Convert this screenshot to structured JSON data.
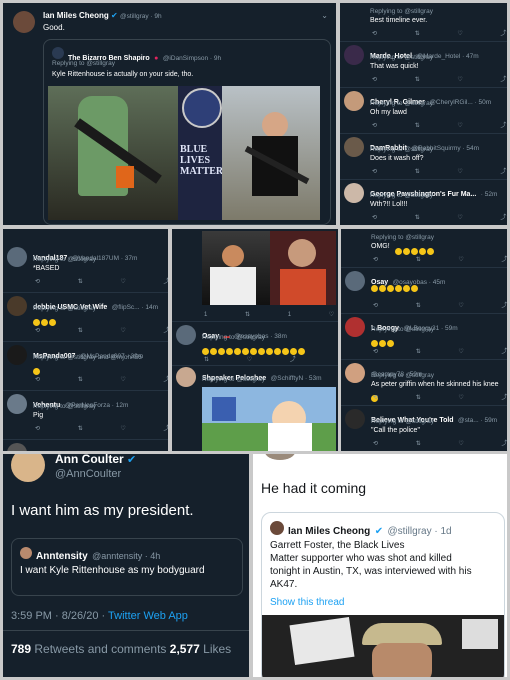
{
  "p1": {
    "author": {
      "name": "Ian Miles Cheong",
      "handle": "@stillgray · 9h"
    },
    "text": "Good.",
    "quoted": {
      "name": "The Bizarro Ben Shapiro",
      "handle": "@iDanSimpson · 9h",
      "reply": "Replying to @stillgray",
      "text": "Kyle Rittenhouse is actually on your side, tho.",
      "sign": [
        "BLUE",
        "LIVES",
        "MATTER"
      ]
    }
  },
  "p2": {
    "tweets": [
      {
        "name": "",
        "handle": "",
        "reply": "Replying to @stillgray",
        "text": "Best timeline ever."
      },
      {
        "name": "Marde_Hotel",
        "handle": "@Marde_Hotel · 47m",
        "reply": "Replying to @stillgray",
        "text": "That was quick!"
      },
      {
        "name": "Cheryl R. Gilmer",
        "handle": "@CherylRGil... · 50m",
        "reply": "Replying to @stillgray",
        "text": "Oh my lawd"
      },
      {
        "name": "DamRabbit",
        "handle": "@RabbitSquirmy · 54m",
        "reply": "Replying to @stillgray",
        "text": "Does it wash off?"
      },
      {
        "name": "George Pawshington's Fur Ma...",
        "handle": "· 52m",
        "reply": "Replying to @stillgray",
        "text": "Wth?!! Lol!!!"
      }
    ]
  },
  "p3": {
    "tweets": [
      {
        "name": "Vandal187",
        "handle": "@Vandal187UM · 37m",
        "reply": "Replying to @stillgray",
        "text": "*BASED"
      },
      {
        "name": "debbie USMC Vet Wife",
        "handle": "@flipSc... · 14m",
        "reply": "Replying to @stillgray",
        "text": ""
      },
      {
        "name": "MsPanda007",
        "handle": "@MsPanda007 · 39m",
        "reply": "Replying to @stillgray and @mjohn55",
        "text": ""
      },
      {
        "name": "Vehentu",
        "handle": "@PerNonForza · 12m",
        "reply": "Replying to @stillgray",
        "text": "Pig"
      },
      {
        "name": "Liberty Pact",
        "handle": "@LibertyPact · 45m",
        "reply": "",
        "text": ""
      }
    ]
  },
  "p4": {
    "tweets": [
      {
        "name": "Osay",
        "handle": "@osayobas · 38m",
        "reply": "Replying to @stillgray",
        "text": ""
      },
      {
        "name": "Shpeaker Peloshee",
        "handle": "@SchifftyN · 53m",
        "reply": "Replying to @stillgray",
        "text": ""
      }
    ]
  },
  "p5": {
    "tweets": [
      {
        "name": "",
        "handle": "",
        "reply": "Replying to @stillgray",
        "text": "OMG!"
      },
      {
        "name": "Osay",
        "handle": "@osayobas · 45m",
        "reply": "",
        "text": ""
      },
      {
        "name": "L Boogy",
        "handle": "@LBoogy31 · 59m",
        "reply": "Replying to @stillgray",
        "text": ""
      },
      {
        "name": "",
        "handle": "@campy78 · 59m",
        "reply": "Replying to @stillgray",
        "text": "As peter griffin when he skinned his knee"
      },
      {
        "name": "Believe What You're Told",
        "handle": "@sta... · 59m",
        "reply": "Replying to @stillgray",
        "text": "\"Call the police\""
      }
    ]
  },
  "p6": {
    "name": "Ann Coulter",
    "handle": "@AnnCoulter",
    "text": "I want him as my president.",
    "quoted": {
      "name": "Anntensity",
      "handle": "@anntensity · 4h",
      "text": "I want Kyle Rittenhouse as my bodyguard"
    },
    "time": "3:59 PM · 8/26/20 · ",
    "app": "Twitter Web App",
    "retweets": "789",
    "retweets_label": "Retweets and comments",
    "likes": "2,577",
    "likes_label": "Likes"
  },
  "p7": {
    "text": "He had it coming",
    "quoted": {
      "name": "Ian Miles Cheong",
      "handle": "@stillgray · 1d",
      "text": [
        "Garrett Foster, the Black Lives",
        "Matter supporter who was shot and killed",
        "tonight in Austin, TX, was interviewed with his",
        "AK47."
      ],
      "link": "Show this thread"
    }
  },
  "colors": {
    "bg": "#15202b",
    "accent": "#1da1f2",
    "muted": "#8899a6"
  }
}
